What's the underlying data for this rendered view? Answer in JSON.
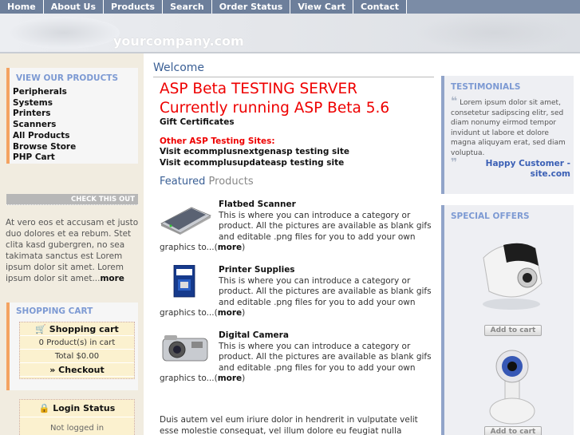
{
  "nav": [
    "Home",
    "About Us",
    "Products",
    "Search",
    "Order Status",
    "View Cart",
    "Contact"
  ],
  "logo": "yourcompany.com",
  "left": {
    "categories_title": "VIEW OUR PRODUCTS",
    "categories": [
      "Peripherals",
      "Systems",
      "Printers",
      "Scanners",
      "All Products",
      "Browse Store",
      "PHP Cart"
    ],
    "checkout_title": "CHECK THIS OUT",
    "checkout_text": "At vero eos et accusam et justo duo dolores et ea rebum. Stet clita kasd gubergren, no sea takimata sanctus est Lorem ipsum dolor sit amet. Lorem ipsum dolor sit amet...",
    "checkout_more": "more",
    "cart_title": "SHOPPING CART",
    "cart_label": "Shopping cart",
    "cart_count": "0 Product(s) in cart",
    "cart_total": "Total $0.00",
    "checkout_link": "» Checkout",
    "login_title": "Login Status",
    "login_state": "Not logged in"
  },
  "main": {
    "welcome": "Welcome",
    "headline_1": "ASP Beta TESTING SERVER",
    "headline_2": "Currently running ASP Beta 5.6",
    "gift": "Gift Certificates",
    "other_title": "Other ASP Testing Sites:",
    "visit_1": "Visit ecommplusnextgenasp testing site",
    "visit_2": "Visit ecommplusupdateasp testing site",
    "featured_1": "Featured",
    "featured_2": "Products",
    "products": [
      {
        "name": "Flatbed Scanner",
        "desc": "This is where you can introduce a category or product. All the pictures are available as blank gifs and editable .png files for you to add your own graphics to...(",
        "more": "more",
        ")": ")"
      },
      {
        "name": "Printer Supplies",
        "desc": "This is where you can introduce a category or product. All the pictures are available as blank gifs and editable .png files for you to add your own graphics to...(",
        "more": "more"
      },
      {
        "name": "Digital Camera",
        "desc": "This is where you can introduce a category or product. All the pictures are available as blank gifs and editable .png files for you to add your own graphics to...(",
        "more": "more"
      }
    ],
    "lorem": "Duis autem vel eum iriure dolor in hendrerit in vulputate velit esse molestie consequat, vel illum dolore eu feugiat nulla facilisis"
  },
  "right": {
    "testimonials_title": "TESTIMONIALS",
    "testimonial_text": "Lorem ipsum dolor sit amet, consetetur sadipscing elitr, sed diam nonumy eirmod tempor invidunt ut labore et dolore magna aliquyam erat, sed diam voluptua.",
    "testimonial_by_1": "Happy Customer -",
    "testimonial_by_2": "site.com",
    "specials_title": "SPECIAL OFFERS",
    "add_to_cart": "Add to cart"
  }
}
